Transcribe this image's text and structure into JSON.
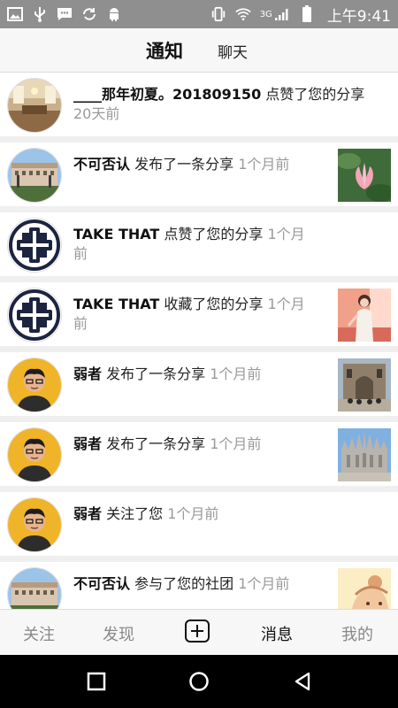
{
  "status_bar": {
    "time": "上午9:41",
    "network": "3G"
  },
  "header": {
    "tabs": [
      {
        "label": "通知",
        "active": true
      },
      {
        "label": "聊天",
        "active": false
      }
    ]
  },
  "notifications": [
    {
      "user": "____那年初夏。201809150",
      "action": " 点赞了您的分享",
      "time": "20天前",
      "avatar": "room",
      "thumb": null
    },
    {
      "user": "不可否认",
      "action": " 发布了一条分享",
      "time": "1个月前",
      "avatar": "building",
      "thumb": "lotus"
    },
    {
      "user": "TAKE THAT",
      "action": " 点赞了您的分享",
      "time": "1个月前",
      "avatar": "emblem",
      "thumb": null
    },
    {
      "user": "TAKE THAT",
      "action": " 收藏了您的分享",
      "time": "1个月前",
      "avatar": "emblem",
      "thumb": "girl"
    },
    {
      "user": "弱者",
      "action": " 发布了一条分享",
      "time": "1个月前",
      "avatar": "man",
      "thumb": "church"
    },
    {
      "user": "弱者",
      "action": " 发布了一条分享",
      "time": "1个月前",
      "avatar": "man",
      "thumb": "cathedral"
    },
    {
      "user": "弱者",
      "action": " 关注了您",
      "time": "1个月前",
      "avatar": "man",
      "thumb": null
    },
    {
      "user": "不可否认",
      "action": " 参与了您的社团",
      "time": "1个月前",
      "avatar": "building",
      "thumb": "cartoon"
    }
  ],
  "bottom_nav": {
    "follow": "关注",
    "discover": "发现",
    "messages": "消息",
    "mine": "我的",
    "active": "消息"
  }
}
